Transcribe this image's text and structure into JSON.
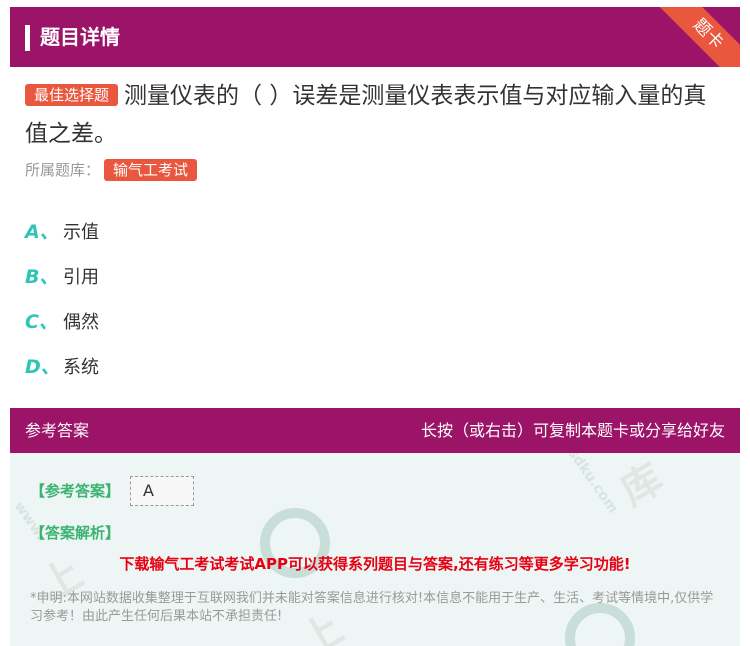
{
  "header": {
    "title": "题目详情",
    "ribbon": "题卡"
  },
  "question": {
    "badge": "最佳选择题",
    "text": "测量仪表的（ ）误差是测量仪表表示值与对应输入量的真值之差。",
    "bank_label": "所属题库：",
    "bank_name": "输气工考试"
  },
  "options": [
    {
      "letter": "A、",
      "text": "示值"
    },
    {
      "letter": "B、",
      "text": "引用"
    },
    {
      "letter": "C、",
      "text": "偶然"
    },
    {
      "letter": "D、",
      "text": "系统"
    }
  ],
  "answer_section": {
    "title": "参考答案",
    "hint": "长按（或右击）可复制本题卡或分享给好友",
    "ref_label": "【参考答案】",
    "answer": "A",
    "analysis_label": "【答案解析】",
    "promo": "下载输气工考试考试APP可以获得系列题目与答案,还有练习等更多学习功能!",
    "disclaimer": "*申明:本网站数据收集整理于互联网我们并未能对答案信息进行核对!本信息不能用于生产、生活、考试等情境中,仅供学习参考！由此产生任何后果本站不承担责任!"
  },
  "colors": {
    "header_bg": "#9c1468",
    "accent": "#e9573f",
    "option_letter": "#2ec4b6",
    "answer_label": "#3cb371",
    "promo": "#e60012"
  }
}
